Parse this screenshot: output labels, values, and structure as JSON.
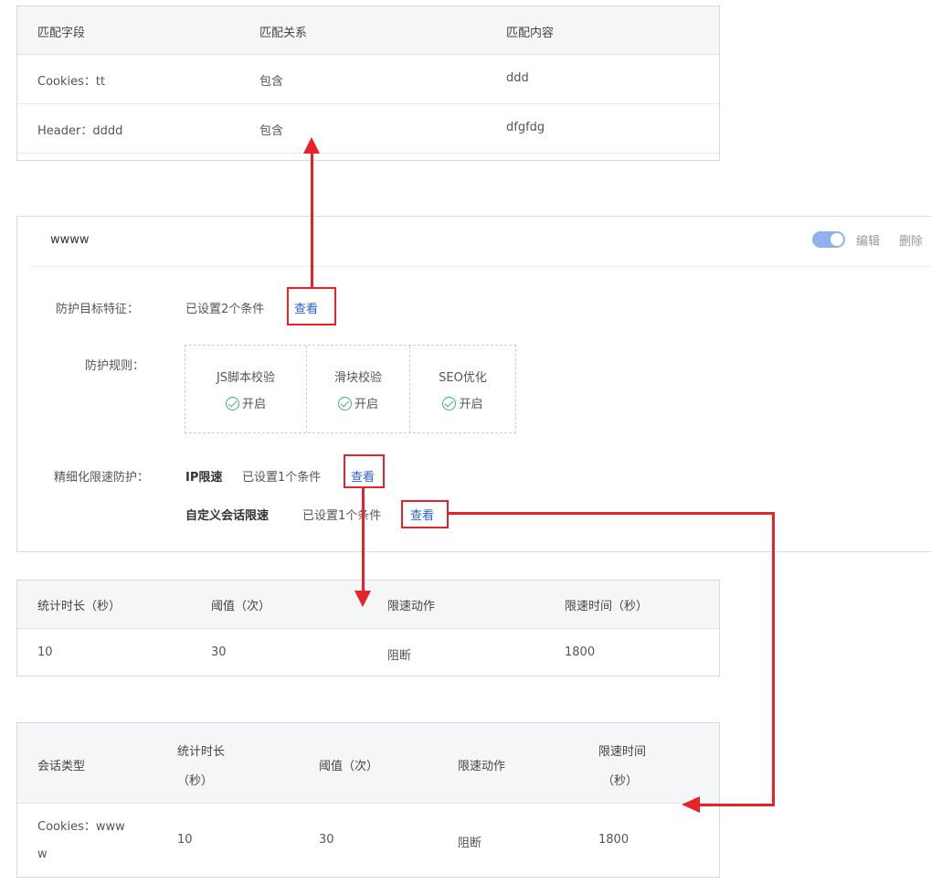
{
  "feature_table": {
    "headers": [
      "匹配字段",
      "匹配关系",
      "匹配内容"
    ],
    "rows": [
      {
        "field": "Cookies：tt",
        "relation": "包含",
        "content": "ddd"
      },
      {
        "field": "Header：dddd",
        "relation": "包含",
        "content": "dfgfdg"
      }
    ]
  },
  "rule_card": {
    "title": "wwww",
    "toggle_on": true,
    "edit_label": "编辑",
    "delete_label": "删除",
    "target_label": "防护目标特征：",
    "target_value": "已设置2个条件",
    "view_label": "查看",
    "rules_label": "防护规则：",
    "rules": [
      {
        "name": "JS脚本校验",
        "status": "开启"
      },
      {
        "name": "滑块校验",
        "status": "开启"
      },
      {
        "name": "SEO优化",
        "status": "开启"
      }
    ],
    "rate_label": "精细化限速防护：",
    "ip_rate": {
      "name": "IP限速",
      "value": "已设置1个条件",
      "view": "查看"
    },
    "session_rate": {
      "name": "自定义会话限速",
      "value": "已设置1个条件",
      "view": "查看"
    }
  },
  "ip_table": {
    "headers": [
      "统计时长（秒）",
      "阈值（次）",
      "限速动作",
      "限速时间（秒）"
    ],
    "row": [
      "10",
      "30",
      "阻断",
      "1800"
    ]
  },
  "session_table": {
    "headers": {
      "type": "会话类型",
      "duration_1": "统计时长",
      "duration_2": "（秒）",
      "threshold": "阈值（次）",
      "action": "限速动作",
      "limit_1": "限速时间",
      "limit_2": "（秒）"
    },
    "row": {
      "type_1": "Cookies：www",
      "type_2": "w",
      "duration": "10",
      "threshold": "30",
      "action": "阻断",
      "limit": "1800"
    }
  },
  "colors": {
    "accent": "#2a62d8",
    "annotation": "#e8222b",
    "ok": "#3cb371"
  }
}
